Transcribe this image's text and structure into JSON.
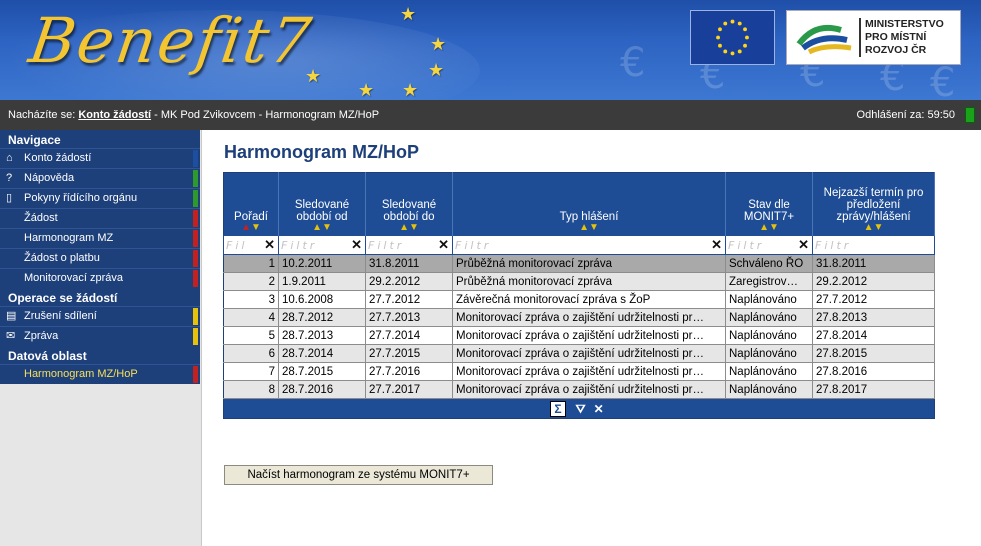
{
  "header": {
    "app_logo_text": "Benefit7",
    "ministry_line1": "MINISTERSTVO",
    "ministry_line2": "PRO MÍSTNÍ",
    "ministry_line3": "ROZVOJ ČR"
  },
  "breadcrumb": {
    "prefix": "Nacházíte se:",
    "link": "Konto žádostí",
    "path": " - MK Pod Zvikovcem - Harmonogram MZ/HoP",
    "logout_text": "Odhlášení za: 59:50"
  },
  "sidebar": {
    "sections": [
      {
        "title": "Navigace",
        "items": [
          {
            "label": "Konto žádostí",
            "icon": "home-icon",
            "strip": "#1d4fa0"
          },
          {
            "label": "Nápověda",
            "icon": "help-icon",
            "strip": "#2e9a2e"
          },
          {
            "label": "Pokyny řídícího orgánu",
            "icon": "book-icon",
            "strip": "#2e9a2e"
          },
          {
            "label": "Žádost",
            "icon": "",
            "strip": "#c32020"
          },
          {
            "label": "Harmonogram MZ",
            "icon": "",
            "strip": "#c32020"
          },
          {
            "label": "Žádost o platbu",
            "icon": "",
            "strip": "#c32020"
          },
          {
            "label": "Monitorovací zpráva",
            "icon": "",
            "strip": "#c32020"
          }
        ]
      },
      {
        "title": "Operace se žádostí",
        "items": [
          {
            "label": "Zrušení sdílení",
            "icon": "document-icon",
            "strip": "#e6c20a"
          },
          {
            "label": "Zpráva",
            "icon": "envelope-icon",
            "strip": "#e6c20a"
          }
        ]
      },
      {
        "title": "Datová oblast",
        "items": [
          {
            "label": "Harmonogram MZ/HoP",
            "icon": "",
            "strip": "#c32020",
            "active": true
          }
        ]
      }
    ]
  },
  "main": {
    "title": "Harmonogram MZ/HoP",
    "table": {
      "columns": [
        "Pořadí",
        "Sledované období od",
        "Sledované období do",
        "Typ hlášení",
        "Stav dle MONIT7+",
        "Nejzazší termín pro předložení zprávy/hlášení"
      ],
      "filter_placeholder": "Filtr",
      "filter_placeholder_short": "Fil",
      "rows": [
        [
          "1",
          "10.2.2011",
          "31.8.2011",
          "Průběžná monitorovací zpráva",
          "Schváleno ŘO",
          "31.8.2011"
        ],
        [
          "2",
          "1.9.2011",
          "29.2.2012",
          "Průběžná monitorovací zpráva",
          "Zaregistrov…",
          "29.2.2012"
        ],
        [
          "3",
          "10.6.2008",
          "27.7.2012",
          "Závěrečná monitorovací zpráva s ŽoP",
          "Naplánováno",
          "27.7.2012"
        ],
        [
          "4",
          "28.7.2012",
          "27.7.2013",
          "Monitorovací zpráva o zajištění udržitelnosti pr…",
          "Naplánováno",
          "27.8.2013"
        ],
        [
          "5",
          "28.7.2013",
          "27.7.2014",
          "Monitorovací zpráva o zajištění udržitelnosti pr…",
          "Naplánováno",
          "27.8.2014"
        ],
        [
          "6",
          "28.7.2014",
          "27.7.2015",
          "Monitorovací zpráva o zajištění udržitelnosti pr…",
          "Naplánováno",
          "27.8.2015"
        ],
        [
          "7",
          "28.7.2015",
          "27.7.2016",
          "Monitorovací zpráva o zajištění udržitelnosti pr…",
          "Naplánováno",
          "27.8.2016"
        ],
        [
          "8",
          "28.7.2016",
          "27.7.2017",
          "Monitorovací zpráva o zajištění udržitelnosti pr…",
          "Naplánováno",
          "27.8.2017"
        ]
      ],
      "footer_icons": [
        "sum-icon",
        "filter-icon",
        "clear-icon"
      ]
    },
    "load_button": "Načíst harmonogram ze systému MONIT7+"
  }
}
